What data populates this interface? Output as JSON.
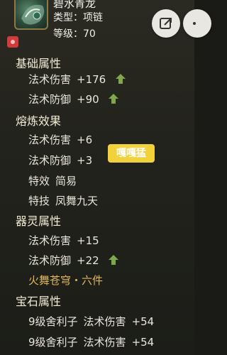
{
  "item": {
    "name": "碧水青龙",
    "type_text": "类型：项链",
    "level_text": "等级：70"
  },
  "header_buttons": [
    {
      "icon": "share-icon"
    },
    {
      "icon": "more-icon"
    }
  ],
  "sections": {
    "base": {
      "title": "基础属性",
      "rows": [
        {
          "label": "法术伤害",
          "value": "+176",
          "up": true
        },
        {
          "label": "法术防御",
          "value": "+90",
          "up": true
        }
      ]
    },
    "refine": {
      "title": "熔炼效果",
      "rows": [
        {
          "label": "法术伤害",
          "value": "+6"
        },
        {
          "label": "法术防御",
          "value": "+3"
        }
      ],
      "effect": {
        "label": "特效",
        "value": "简易"
      },
      "skill": {
        "label": "特技",
        "value": "凤舞九天"
      }
    },
    "spirit": {
      "title": "器灵属性",
      "rows": [
        {
          "label": "法术伤害",
          "value": "+15"
        },
        {
          "label": "法术防御",
          "value": "+22",
          "up": true
        }
      ],
      "set_text": "火舞苍穹・六件"
    },
    "gem": {
      "title": "宝石属性",
      "rows": [
        {
          "gem": "9级舍利子",
          "label": "法术伤害",
          "value": "+54"
        },
        {
          "gem": "9级舍利子",
          "label": "法术伤害",
          "value": "+54"
        }
      ]
    }
  },
  "watermark_tag": "嘎嘎猛",
  "colors": {
    "up_arrow": "#7fa84a",
    "gold_text": "#e2b95a",
    "tag_bg": "#f2d23b",
    "badge_red": "#d33a3a"
  }
}
